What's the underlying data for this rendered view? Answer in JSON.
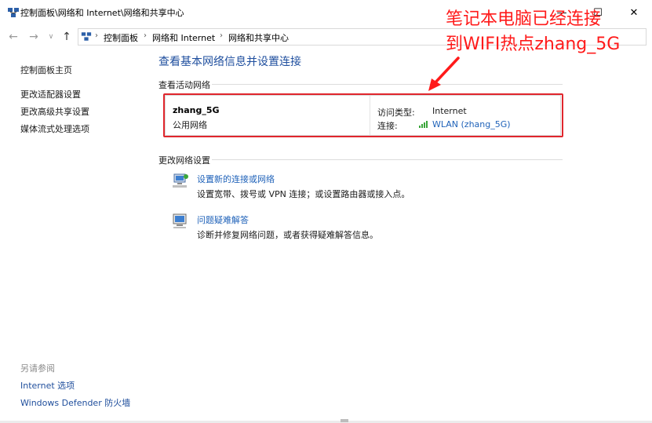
{
  "window": {
    "title": "控制面板\\网络和 Internet\\网络和共享中心",
    "minimize_glyph": "—",
    "maximize_glyph": "☐",
    "close_glyph": "✕"
  },
  "nav": {
    "back_glyph": "←",
    "forward_glyph": "→",
    "history_glyph": "∨",
    "up_glyph": "↑"
  },
  "breadcrumb": {
    "separator": "›",
    "items": [
      "控制面板",
      "网络和 Internet",
      "网络和共享中心"
    ]
  },
  "left_pane": {
    "home": "控制面板主页",
    "links": [
      "更改适配器设置",
      "更改高级共享设置",
      "媒体流式处理选项"
    ],
    "see_also_label": "另请参阅",
    "see_also": [
      "Internet 选项",
      "Windows Defender 防火墙"
    ]
  },
  "main": {
    "title": "查看基本网络信息并设置连接",
    "active_section": "查看活动网络",
    "network_name": "zhang_5G",
    "network_type": "公用网络",
    "access_type_label": "访问类型:",
    "access_type_value": "Internet",
    "connection_label": "连接:",
    "connection_value": "WLAN (zhang_5G)",
    "change_section": "更改网络设置",
    "actions": [
      {
        "title": "设置新的连接或网络",
        "desc": "设置宽带、拨号或 VPN 连接；或设置路由器或接入点。"
      },
      {
        "title": "问题疑难解答",
        "desc": "诊断并修复网络问题，或者获得疑难解答信息。"
      }
    ]
  },
  "annotation": {
    "line1": "笔记本电脑已经连接",
    "line2": "到WIFI热点zhang_5G",
    "color": "#ff1a1a"
  },
  "colors": {
    "accent_link": "#1f62b9",
    "title_blue": "#1e4e9e",
    "highlight_red": "#e0262d",
    "signal_green": "#3aa63a"
  }
}
